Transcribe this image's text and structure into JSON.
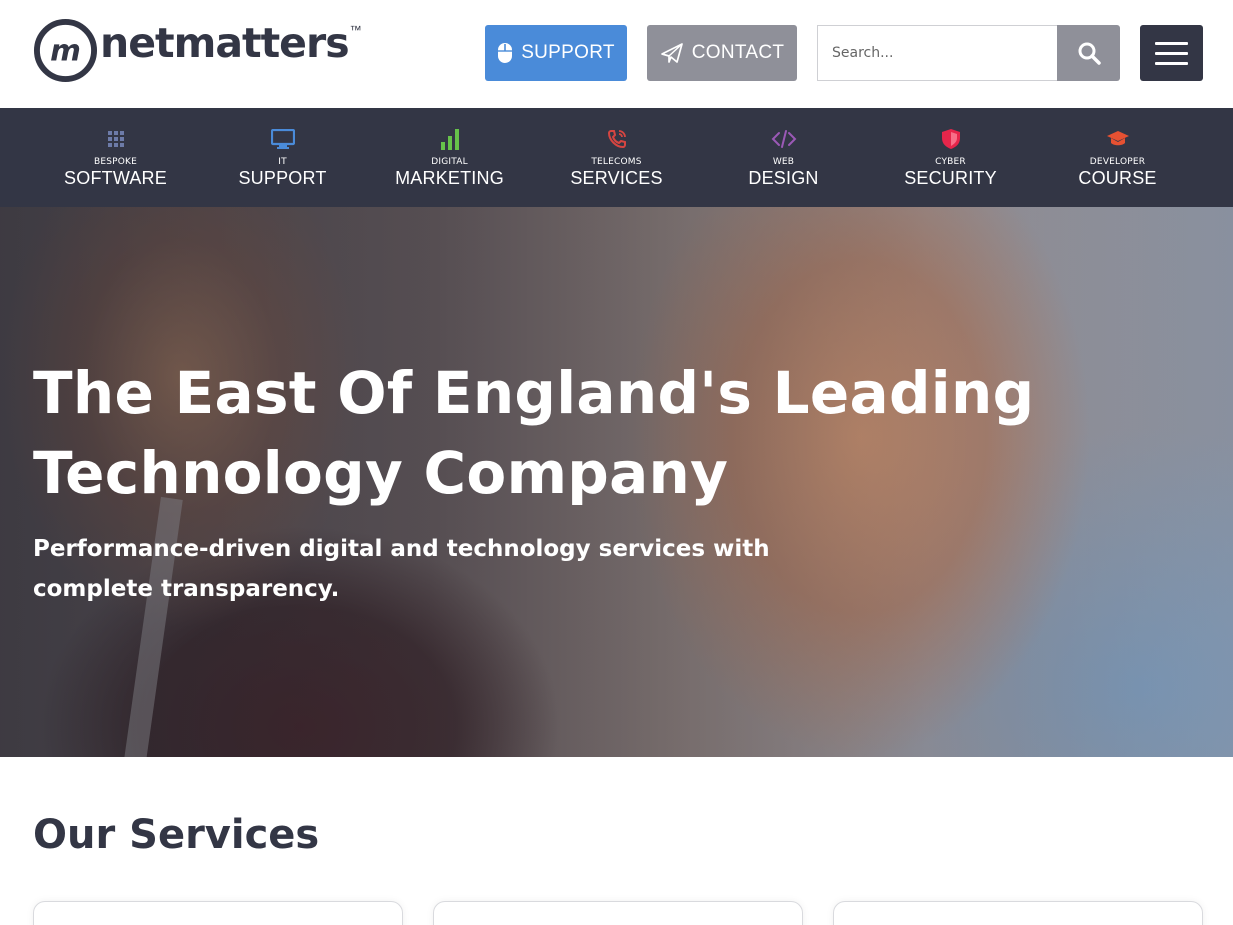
{
  "header": {
    "logo_text": "netmatters",
    "logo_tm": "™",
    "support_label": "SUPPORT",
    "contact_label": "CONTACT",
    "search_placeholder": "Search...",
    "support_color": "#4A8BD9",
    "contact_color": "#8F9099",
    "menu_bg": "#333645"
  },
  "nav": {
    "items": [
      {
        "small": "BESPOKE",
        "big": "SOFTWARE",
        "icon": "grid-icon",
        "color": "#6D7BA8"
      },
      {
        "small": "IT",
        "big": "SUPPORT",
        "icon": "monitor-icon",
        "color": "#4A8BD9"
      },
      {
        "small": "DIGITAL",
        "big": "MARKETING",
        "icon": "bar-chart-icon",
        "color": "#66C24A"
      },
      {
        "small": "TELECOMS",
        "big": "SERVICES",
        "icon": "phone-icon",
        "color": "#D64541"
      },
      {
        "small": "WEB",
        "big": "DESIGN",
        "icon": "code-icon",
        "color": "#9B59B6"
      },
      {
        "small": "CYBER",
        "big": "SECURITY",
        "icon": "shield-icon",
        "color": "#E6264B"
      },
      {
        "small": "DEVELOPER",
        "big": "COURSE",
        "icon": "graduation-cap-icon",
        "color": "#E65132"
      }
    ]
  },
  "hero": {
    "title": "The East Of England's Leading Technology Company",
    "subtitle": "Performance-driven digital and technology services with complete transparency."
  },
  "services": {
    "title": "Our Services"
  }
}
